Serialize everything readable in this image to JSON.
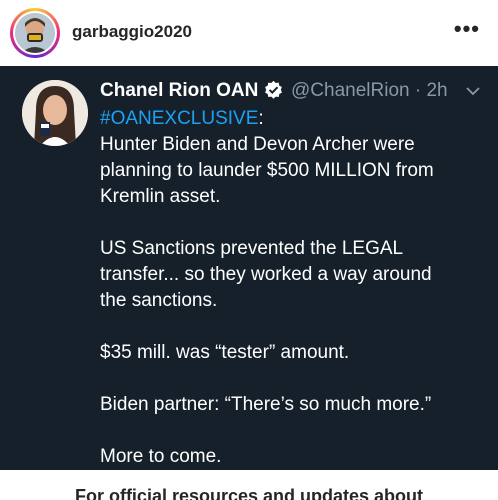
{
  "instagram": {
    "username": "garbaggio2020",
    "more_icon": "more-horizontal-icon",
    "more_text": "•••"
  },
  "tweet": {
    "display_name": "Chanel Rion OAN",
    "handle_time": "@ChanelRion · 2h",
    "verified_icon": "verified-badge-icon",
    "hashtag": "#OANEXCLUSIVE",
    "hashtag_suffix": ":",
    "lines": [
      "Hunter Biden and Devon Archer were",
      "planning to launder $500 MILLION from",
      "Kremlin asset.",
      "",
      "US Sanctions prevented the LEGAL",
      "transfer... so they worked a way around",
      "the sanctions.",
      "",
      "$35 mill. was “tester” amount.",
      "",
      "Biden partner: “There’s so much more.”",
      "",
      "More to come."
    ],
    "colors": {
      "background": "#15202b",
      "hashtag": "#1da1f2",
      "handle": "#8899a6"
    }
  },
  "footer": {
    "text": "For official resources and updates about"
  }
}
